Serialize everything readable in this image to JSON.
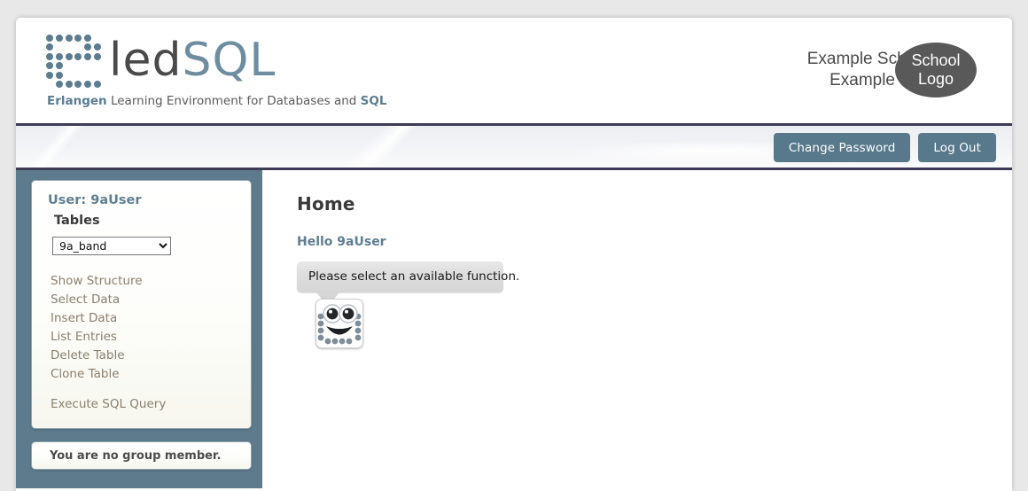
{
  "app": {
    "logo_text_dark": "led",
    "logo_text_blue": "SQL",
    "logo_icon": "dot-matrix-e-icon",
    "tagline_emphasis": "Erlangen",
    "tagline_rest": " Learning Environment for Databases and ",
    "tagline_emphasis2": "SQL"
  },
  "school": {
    "name": "Example School",
    "city": "Example City",
    "logo_line1": "School",
    "logo_line2": "Logo"
  },
  "nav": {
    "change_password": "Change Password",
    "log_out": "Log Out"
  },
  "sidebar": {
    "user_label": "User: 9aUser",
    "tables_label": "Tables",
    "selected_table": "9a_band",
    "table_options": [
      "9a_band"
    ],
    "menu": [
      {
        "label": "Show Structure",
        "name": "show-structure"
      },
      {
        "label": "Select Data",
        "name": "select-data"
      },
      {
        "label": "Insert Data",
        "name": "insert-data"
      },
      {
        "label": "List Entries",
        "name": "list-entries"
      },
      {
        "label": "Delete Table",
        "name": "delete-table"
      },
      {
        "label": "Clone Table",
        "name": "clone-table"
      }
    ],
    "execute_query": "Execute SQL Query",
    "group_status": "You are no group member."
  },
  "main": {
    "title": "Home",
    "greeting": "Hello 9aUser",
    "bubble_message": "Please select an available function.",
    "mascot_icon": "robot-face-icon"
  },
  "colors": {
    "accent_slate": "#5d7b8c",
    "nav_border": "#3d3b55",
    "button": "#58798c",
    "menu_link": "#8a7f6e",
    "school_logo_bg": "#595959"
  }
}
